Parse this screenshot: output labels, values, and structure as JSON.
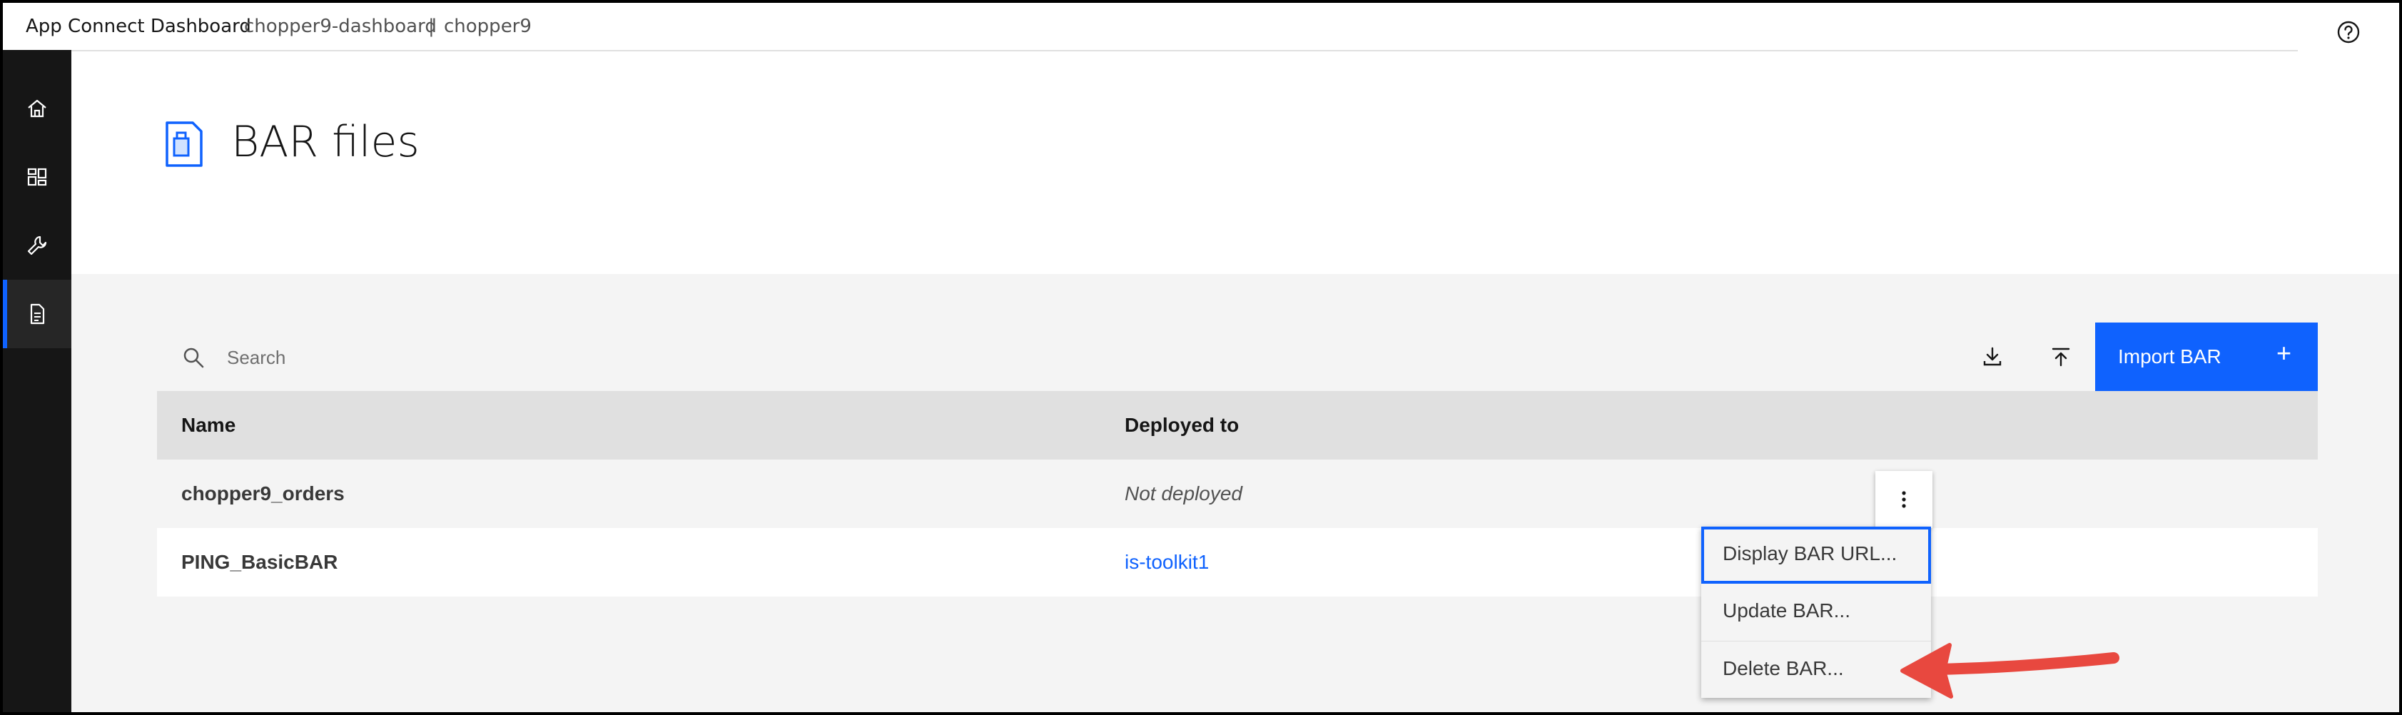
{
  "header": {
    "app_title": "App Connect Dashboard",
    "breadcrumb": [
      "chopper9-dashboard",
      "chopper9"
    ],
    "separator": "|"
  },
  "sidenav": {
    "items": [
      {
        "icon": "home-icon"
      },
      {
        "icon": "dashboard-icon"
      },
      {
        "icon": "wrench-icon"
      },
      {
        "icon": "document-icon",
        "active": true
      }
    ]
  },
  "page": {
    "title": "BAR files",
    "icon": "bar-file-icon"
  },
  "toolbar": {
    "search_placeholder": "Search",
    "download_icon": "download-icon",
    "upload_icon": "upload-icon",
    "import_label": "Import BAR",
    "import_plus": "+"
  },
  "table": {
    "columns": [
      "Name",
      "Deployed to"
    ],
    "rows": [
      {
        "name": "chopper9_orders",
        "deployed": "Not deployed"
      },
      {
        "name": "PING_BasicBAR",
        "deployed": "is-toolkit1"
      }
    ]
  },
  "overflow_menu": {
    "items": [
      "Display BAR URL...",
      "Update BAR...",
      "Delete BAR..."
    ]
  },
  "colors": {
    "accent": "#0f62fe",
    "nav_bg": "#161616",
    "content_bg": "#f4f4f4",
    "arrow": "#e8483f"
  }
}
